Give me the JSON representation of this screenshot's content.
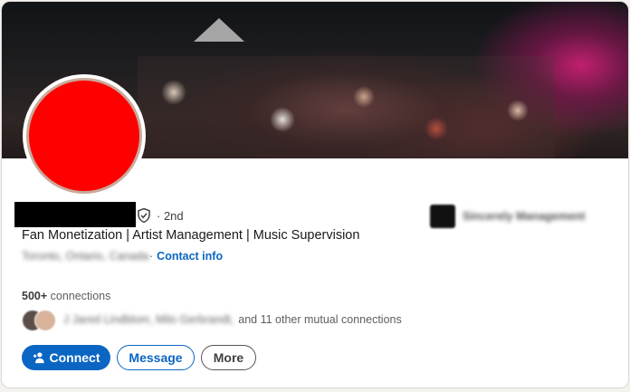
{
  "profile": {
    "degree": "· 2nd",
    "headline": "Fan Monetization | Artist Management | Music Supervision",
    "location": "Toronto, Ontario, Canada",
    "contact_sep": "·",
    "contact_label": "Contact info",
    "company": "Sincerely Management",
    "connections_count": "500+",
    "connections_label": "connections",
    "mutual_names": "J Jared Lindblom, Milo Gerbrandt,",
    "mutual_other": "and 11 other mutual connections"
  },
  "actions": {
    "connect_label": "Connect",
    "message_label": "Message",
    "more_label": "More"
  },
  "colors": {
    "accent": "#0a66c2",
    "avatar_fill": "#ff0000",
    "redaction": "#000000"
  },
  "icons": {
    "verification": "shield-check-icon",
    "connect": "add-person-icon"
  }
}
